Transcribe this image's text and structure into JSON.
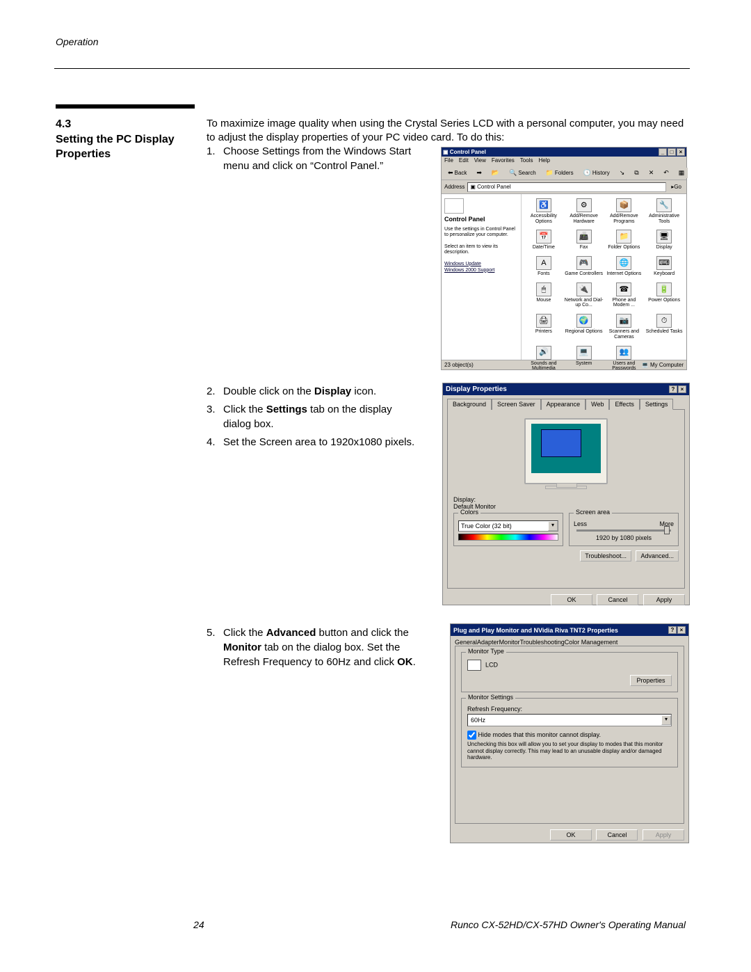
{
  "header": {
    "section_label": "Operation"
  },
  "section": {
    "number": "4.3",
    "title": "Setting the PC Display Properties"
  },
  "intro": "To maximize image quality when using the Crystal Series LCD with a personal computer, you may need to adjust the display properties of your PC video card. To do this:",
  "steps": {
    "s1": "Choose Settings from the Windows Start menu and click on “Control Panel.”",
    "s2a": "Double click on the ",
    "s2b_bold": "Display",
    "s2c": " icon.",
    "s3a": "Click the ",
    "s3b_bold": "Settings",
    "s3c": " tab on the display dialog box.",
    "s4": "Set the Screen area to 1920x1080 pixels.",
    "s5a": "Click the ",
    "s5b_bold": "Advanced",
    "s5c": " button and click the ",
    "s5d_bold": "Monitor",
    "s5e": " tab on the dialog box. Set the Refresh Frequency to 60Hz and click ",
    "s5f_bold": "OK",
    "s5g": "."
  },
  "fig1": {
    "title": "Control Panel",
    "menus": [
      "File",
      "Edit",
      "View",
      "Favorites",
      "Tools",
      "Help"
    ],
    "tb_back": "Back",
    "tb_search": "Search",
    "tb_folders": "Folders",
    "tb_history": "History",
    "address_label": "Address",
    "address_value": "Control Panel",
    "go": "Go",
    "sidebar": {
      "title": "Control Panel",
      "desc": "Use the settings in Control Panel to personalize your computer.",
      "select_hint": "Select an item to view its description.",
      "link1": "Windows Update",
      "link2": "Windows 2000 Support"
    },
    "icons": [
      {
        "glyph": "♿",
        "label": "Accessibility Options"
      },
      {
        "glyph": "⚙",
        "label": "Add/Remove Hardware"
      },
      {
        "glyph": "📦",
        "label": "Add/Remove Programs"
      },
      {
        "glyph": "🔧",
        "label": "Administrative Tools"
      },
      {
        "glyph": "📅",
        "label": "Date/Time"
      },
      {
        "glyph": "📠",
        "label": "Fax"
      },
      {
        "glyph": "📁",
        "label": "Folder Options"
      },
      {
        "glyph": "🖥",
        "label": "Display"
      },
      {
        "glyph": "A",
        "label": "Fonts"
      },
      {
        "glyph": "🎮",
        "label": "Game Controllers"
      },
      {
        "glyph": "🌐",
        "label": "Internet Options"
      },
      {
        "glyph": "⌨",
        "label": "Keyboard"
      },
      {
        "glyph": "🖱",
        "label": "Mouse"
      },
      {
        "glyph": "🔌",
        "label": "Network and Dial-up Co..."
      },
      {
        "glyph": "☎",
        "label": "Phone and Modem ..."
      },
      {
        "glyph": "🔋",
        "label": "Power Options"
      },
      {
        "glyph": "🖨",
        "label": "Printers"
      },
      {
        "glyph": "🌍",
        "label": "Regional Options"
      },
      {
        "glyph": "📷",
        "label": "Scanners and Cameras"
      },
      {
        "glyph": "⏱",
        "label": "Scheduled Tasks"
      },
      {
        "glyph": "🔊",
        "label": "Sounds and Multimedia"
      },
      {
        "glyph": "💻",
        "label": "System"
      },
      {
        "glyph": "👥",
        "label": "Users and Passwords"
      }
    ],
    "status_left": "23 object(s)",
    "status_right": "My Computer"
  },
  "fig2": {
    "title": "Display Properties",
    "tabs": [
      "Background",
      "Screen Saver",
      "Appearance",
      "Web",
      "Effects",
      "Settings"
    ],
    "active_tab": "Settings",
    "display_label": "Display:",
    "display_value": "Default Monitor",
    "colors_legend": "Colors",
    "colors_value": "True Color (32 bit)",
    "area_legend": "Screen area",
    "area_less": "Less",
    "area_more": "More",
    "area_value": "1920 by 1080 pixels",
    "btn_troubleshoot": "Troubleshoot...",
    "btn_advanced": "Advanced...",
    "btn_ok": "OK",
    "btn_cancel": "Cancel",
    "btn_apply": "Apply"
  },
  "fig3": {
    "title": "Plug and Play Monitor and NVidia Riva TNT2 Properties",
    "tabs": [
      "General",
      "Adapter",
      "Monitor",
      "Troubleshooting",
      "Color Management"
    ],
    "active_tab": "Monitor",
    "type_legend": "Monitor Type",
    "type_value": "LCD",
    "btn_properties": "Properties",
    "settings_legend": "Monitor Settings",
    "refresh_label": "Refresh Frequency:",
    "refresh_value": "60Hz",
    "hide_modes": "Hide modes that this monitor cannot display.",
    "note": "Unchecking this box will allow you to set your display to modes that this monitor cannot display correctly. This may lead to an unusable display and/or damaged hardware.",
    "btn_ok": "OK",
    "btn_cancel": "Cancel",
    "btn_apply": "Apply"
  },
  "footer": {
    "page": "24",
    "title": "Runco CX-52HD/CX-57HD Owner's Operating Manual"
  }
}
